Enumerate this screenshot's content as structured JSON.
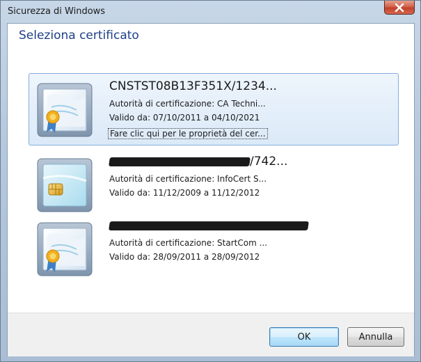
{
  "window": {
    "title": "Sicurezza di Windows"
  },
  "dialog": {
    "heading": "Seleziona certificato"
  },
  "certificates": [
    {
      "title": "CNSTST08B13F351X/1234...",
      "issuer": "Autorità di certificazione: CA Techni...",
      "validity": "Valido da: 07/10/2011 a 04/10/2021",
      "link": "Fare clic qui per le proprietà del cer...",
      "icon": "certificate-ribbon-icon",
      "selected": true
    },
    {
      "title_suffix": "/742...",
      "issuer": "Autorità di certificazione: InfoCert S...",
      "validity": "Valido da: 11/12/2009 a 11/12/2012",
      "icon": "smartcard-certificate-icon",
      "selected": false
    },
    {
      "issuer": "Autorità di certificazione: StartCom ...",
      "validity": "Valido da: 28/09/2011 a 28/09/2012",
      "icon": "certificate-ribbon-icon",
      "selected": false
    }
  ],
  "buttons": {
    "ok": "OK",
    "cancel": "Annulla"
  },
  "colors": {
    "heading": "#1e3f87",
    "selection": "#dbe9f8",
    "selection_border": "#84acdd",
    "close_button": "#c7503a"
  }
}
